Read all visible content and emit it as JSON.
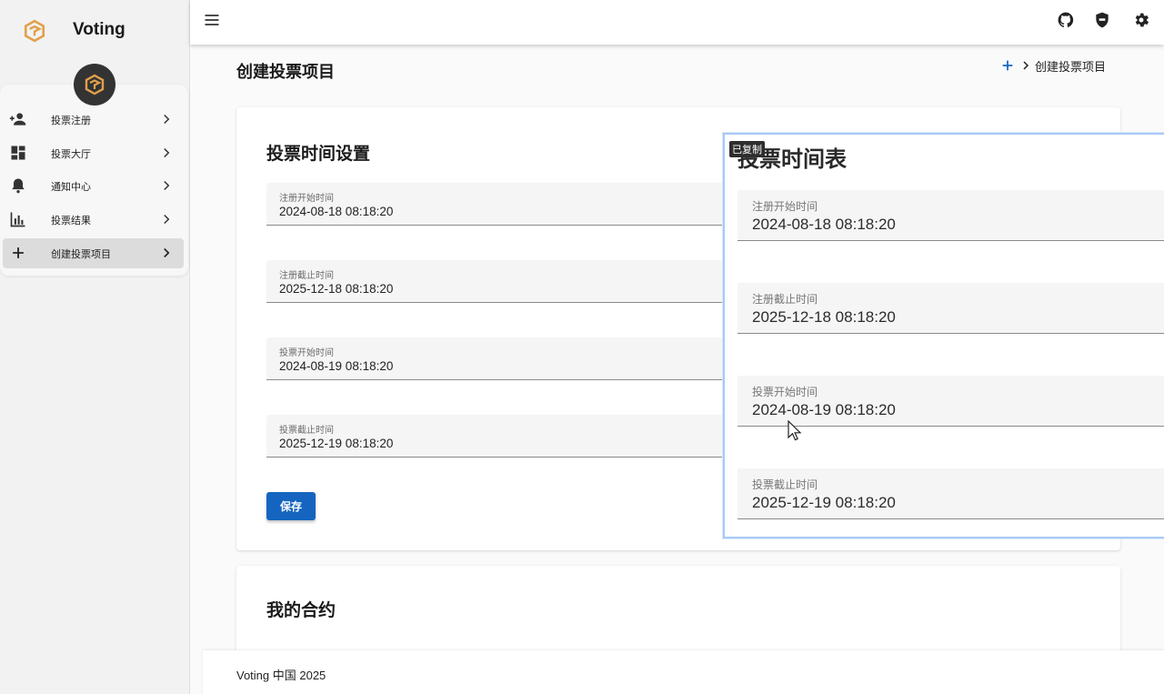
{
  "app": {
    "title": "Voting"
  },
  "sidebar": {
    "items": [
      {
        "label": "投票注册",
        "icon": "person-add-icon"
      },
      {
        "label": "投票大厅",
        "icon": "dashboard-icon"
      },
      {
        "label": "通知中心",
        "icon": "bell-icon"
      },
      {
        "label": "投票结果",
        "icon": "bar-chart-icon"
      },
      {
        "label": "创建投票项目",
        "icon": "plus-icon",
        "active": true
      }
    ]
  },
  "topbar": {
    "icons": [
      "menu-icon",
      "github-icon",
      "shield-icon",
      "gear-icon"
    ]
  },
  "page": {
    "title": "创建投票项目",
    "breadcrumb": "创建投票项目"
  },
  "time_settings": {
    "title": "投票时间设置",
    "fields": [
      {
        "label": "注册开始时间",
        "value": "2024-08-18 08:18:20"
      },
      {
        "label": "注册截止时间",
        "value": "2025-12-18 08:18:20"
      },
      {
        "label": "投票开始时间",
        "value": "2024-08-19 08:18:20"
      },
      {
        "label": "投票截止时间",
        "value": "2025-12-19 08:18:20"
      }
    ],
    "save_label": "保存"
  },
  "contracts": {
    "title": "我的合约"
  },
  "footer": {
    "text": "Voting 中国 2025"
  },
  "overlay": {
    "title": "投票时间表",
    "copied_badge": "已复制",
    "fields": [
      {
        "label": "注册开始时间",
        "value": "2024-08-18 08:18:20"
      },
      {
        "label": "注册截止时间",
        "value": "2025-12-18 08:18:20"
      },
      {
        "label": "投票开始时间",
        "value": "2024-08-19 08:18:20"
      },
      {
        "label": "投票截止时间",
        "value": "2025-12-19 08:18:20"
      }
    ]
  },
  "colors": {
    "accent": "#1565c0",
    "logo": "#e2a04a",
    "sidebar_bg": "#f2f2f2"
  }
}
